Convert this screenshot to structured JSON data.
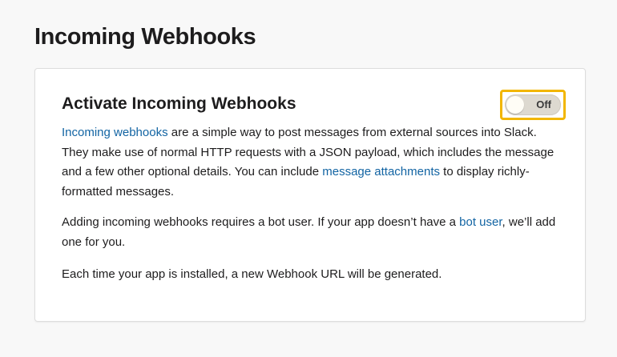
{
  "page": {
    "title": "Incoming Webhooks"
  },
  "section": {
    "title": "Activate Incoming Webhooks",
    "toggle": {
      "label": "Off",
      "state": "off"
    },
    "paragraph1": {
      "link1": "Incoming webhooks",
      "text1": " are a simple way to post messages from external sources into Slack. They make use of normal HTTP requests with a JSON payload, which includes the message and a few other optional details. You can include ",
      "link2": "message attachments",
      "text2": " to display richly-formatted messages."
    },
    "paragraph2": {
      "text1": "Adding incoming webhooks requires a bot user. If your app doesn’t have a ",
      "link1": "bot user",
      "text2": ", we’ll add one for you."
    },
    "paragraph3": {
      "text": "Each time your app is installed, a new Webhook URL will be generated."
    }
  },
  "colors": {
    "link": "#1264a3",
    "toggle_highlight": "#f2b600",
    "background": "#f8f8f8"
  }
}
